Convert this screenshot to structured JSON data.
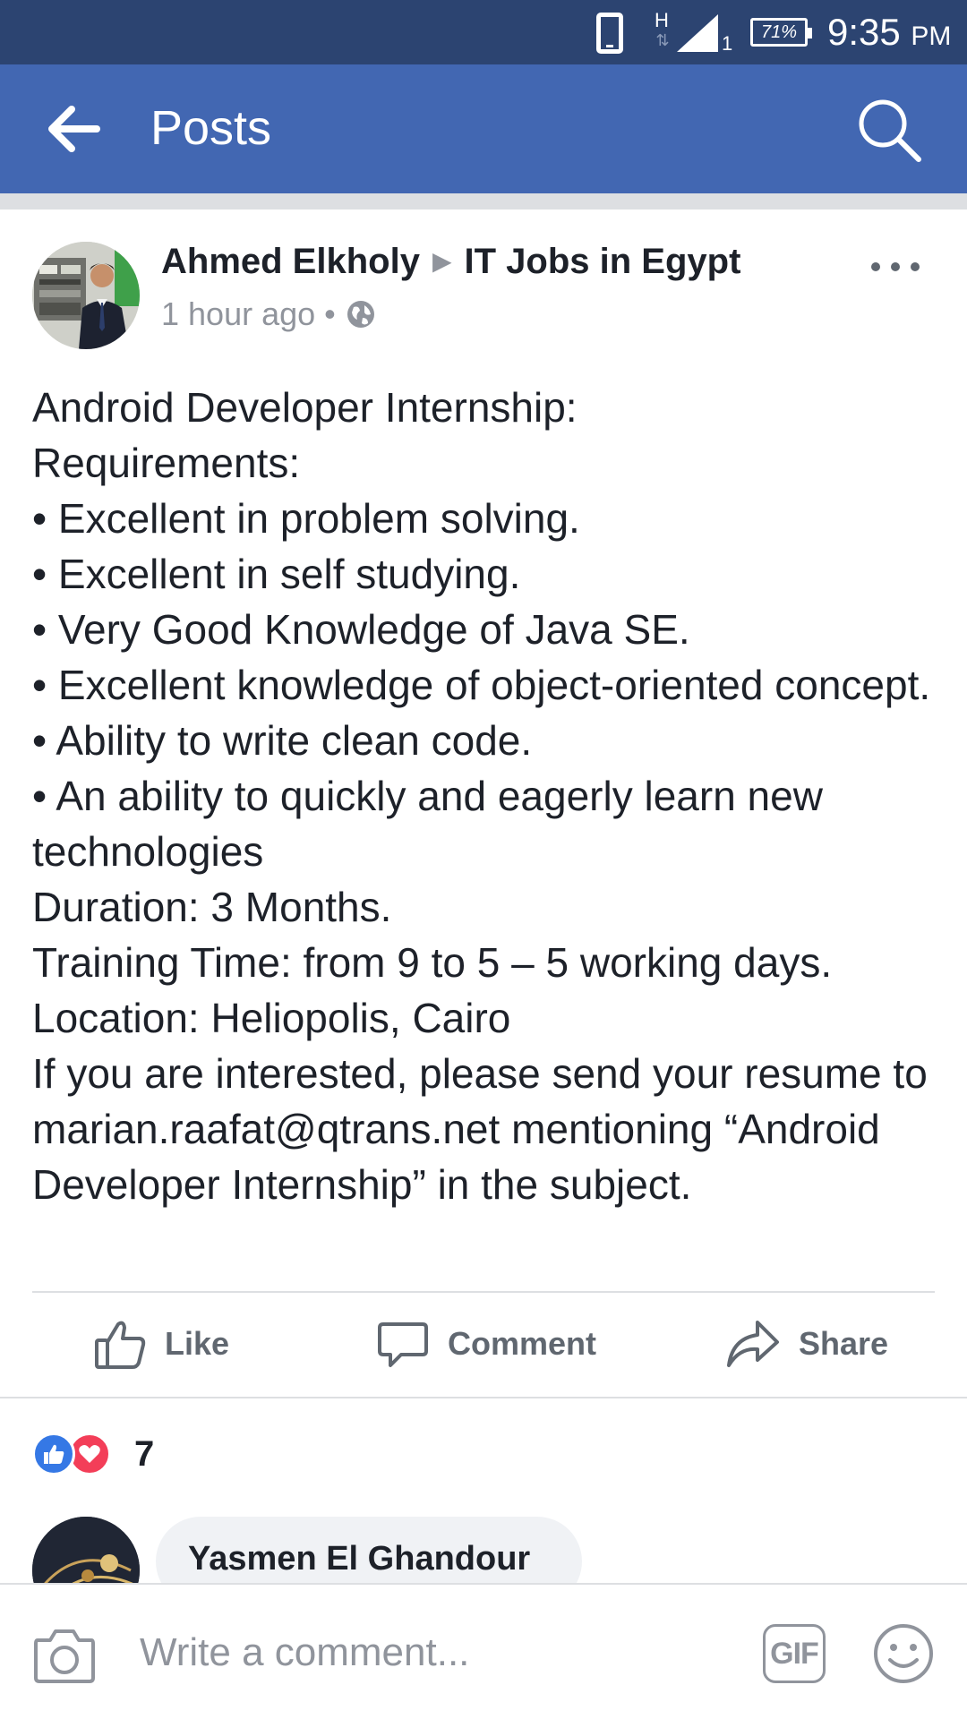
{
  "status_bar": {
    "network": "H",
    "network_arrows": "⇅",
    "signal_sub": "1",
    "battery": "71%",
    "time": "9:35",
    "ampm": "PM"
  },
  "nav": {
    "title": "Posts",
    "back_icon": "arrow-left-icon",
    "search_icon": "search-icon"
  },
  "post": {
    "author": "Ahmed Elkholy",
    "separator": "▶",
    "group": "IT Jobs in Egypt",
    "time_ago": "1 hour ago",
    "dot": "•",
    "privacy_icon": "globe-icon",
    "lines": [
      "Android Developer Internship:",
      "Requirements:",
      "• Excellent in problem solving.",
      "• Excellent in self studying.",
      "• Very Good Knowledge of Java SE.",
      "• Excellent knowledge of object-oriented concept.",
      "• Ability to write clean code.",
      "• An ability to quickly and eagerly learn new technologies",
      "Duration: 3 Months.",
      "Training Time: from 9 to 5 – 5 working days.",
      "Location: Heliopolis, Cairo",
      "If you are interested, please send your resume to marian.raafat@qtrans.net mentioning “Android Developer Internship” in the subject."
    ]
  },
  "actions": {
    "like": "Like",
    "comment": "Comment",
    "share": "Share"
  },
  "reactions": {
    "count": "7",
    "types": [
      "like",
      "love"
    ]
  },
  "comment_preview": {
    "name": "Yasmen El Ghandour"
  },
  "composer": {
    "placeholder": "Write a comment...",
    "gif_label": "GIF",
    "camera_icon": "camera-icon",
    "emoji_icon": "emoji-icon"
  },
  "colors": {
    "status_bar": "#2c4471",
    "nav_bar": "#4267b2",
    "like_blue": "#3578e5",
    "love_red": "#f33e58",
    "secondary_text": "#90949c"
  }
}
